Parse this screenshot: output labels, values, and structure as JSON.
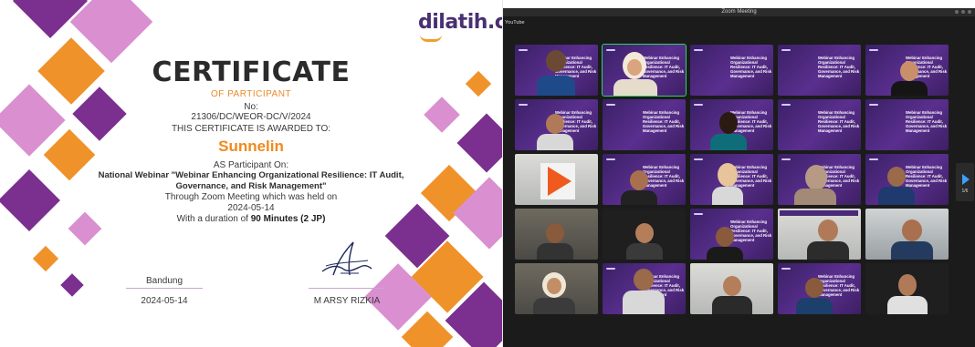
{
  "certificate": {
    "brand": {
      "name": "dilatih",
      "tld": ".co"
    },
    "title": "CERTIFICATE",
    "subtitle": "OF PARTICIPANT",
    "number_label": "No:",
    "number": "21306/DC/WEOR-DC/V/2024",
    "awarded_to": "THIS CERTIFICATE IS AWARDED TO:",
    "recipient": "Sunnelin",
    "as_participant": "AS Participant On:",
    "event": "National Webinar \"Webinar Enhancing Organizational Resilience: IT Audit, Governance, and Risk Management\"",
    "held_via": "Through Zoom Meeting which was held on",
    "event_date": "2024-05-14",
    "duration_prefix": "With a duration of",
    "duration": "90 Minutes (2 JP)",
    "city": "Bandung",
    "issue_date": "2024-05-14",
    "signer": "M ARSY RIZKIA",
    "colors": {
      "purple": "#7b2f8e",
      "pink": "#d98fd0",
      "orange": "#f0922a",
      "title": "#2b2b2b"
    }
  },
  "zoom": {
    "window_title": "Zoom Meeting",
    "source_label": "YouTube",
    "page_indicator": "1/6",
    "slide_text": "Webinar Enhancing Organizational Resilience: IT Audit, Governance, and Risk Management",
    "participant_tiles": 25,
    "active_speaker_color": "#2fd36a"
  }
}
